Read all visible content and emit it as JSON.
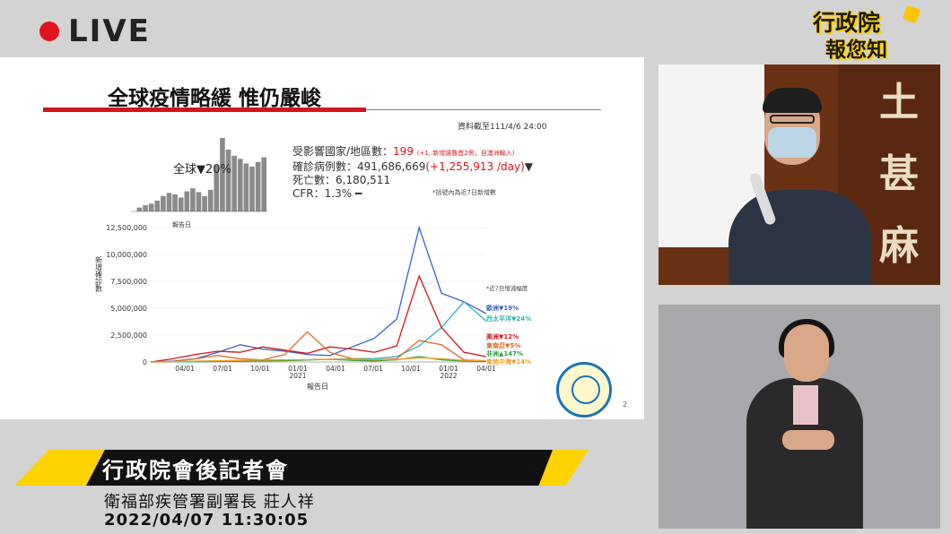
{
  "live": {
    "text": "LIVE"
  },
  "brand": {
    "line1": "行政院",
    "line2": "報您知"
  },
  "slide": {
    "title": "全球疫情略緩 惟仍嚴峻",
    "as_of": "資料截至111/4/6 24:00",
    "stats": {
      "countries_label": "受影響國家/地區數：",
      "countries_value": "199",
      "countries_note": "(+1, 新增諾魯首2例，自澳洲輸入)",
      "cases_label": "確診病例數：491,686,669",
      "cases_delta": "(+1,255,913 /day)",
      "cases_trend": "▼",
      "deaths": "死亡數：6,180,511",
      "cfr": "CFR：1.3%",
      "cfr_trend": "━"
    },
    "avg_note": "*括號內為近7日新增數",
    "mini_chart_label": "全球▼20%",
    "mini_x_label": "報告日",
    "page_number": "2"
  },
  "chart_data": {
    "type": "line",
    "ylabel": "新增確診數",
    "xlabel": "報告日",
    "y_ticks": [
      "12,500,000",
      "10,000,000",
      "7,500,000",
      "5,000,000",
      "2,500,000",
      "0"
    ],
    "ylim": [
      0,
      12500000
    ],
    "x_ticks": [
      "04/01",
      "07/01",
      "10/01",
      "01/01\n2021",
      "04/01",
      "07/01",
      "10/01",
      "01/01\n2022",
      "04/01"
    ],
    "legend_title": "近7日增減幅度",
    "series": [
      {
        "name": "歐洲▼19%",
        "color": "#3a63c8",
        "values": [
          0,
          80000,
          300000,
          900000,
          1600000,
          1200000,
          1000000,
          700000,
          600000,
          1400000,
          2200000,
          4000000,
          12500000,
          6400000,
          5600000,
          4500000
        ]
      },
      {
        "name": "西太平洋▼24%",
        "color": "#2ab5b5",
        "values": [
          0,
          10000,
          20000,
          40000,
          60000,
          80000,
          120000,
          180000,
          260000,
          300000,
          320000,
          500000,
          1500000,
          3200000,
          5600000,
          3800000
        ]
      },
      {
        "name": "美洲▼12%",
        "color": "#d2161e",
        "values": [
          0,
          300000,
          700000,
          1000000,
          900000,
          1400000,
          1100000,
          800000,
          1400000,
          1200000,
          900000,
          1500000,
          8000000,
          3200000,
          900000,
          500000
        ]
      },
      {
        "name": "東南亞▼5%",
        "color": "#e06a2a",
        "values": [
          0,
          50000,
          300000,
          600000,
          300000,
          200000,
          700000,
          2800000,
          900000,
          300000,
          200000,
          300000,
          2000000,
          1600000,
          200000,
          100000
        ]
      },
      {
        "name": "非洲▲147%",
        "color": "#2aa33a",
        "values": [
          0,
          20000,
          60000,
          80000,
          100000,
          120000,
          140000,
          200000,
          250000,
          150000,
          100000,
          200000,
          500000,
          200000,
          80000,
          60000
        ]
      },
      {
        "name": "東地中海▼14%",
        "color": "#f0a020",
        "values": [
          0,
          30000,
          80000,
          120000,
          150000,
          180000,
          200000,
          220000,
          260000,
          240000,
          200000,
          220000,
          400000,
          300000,
          150000,
          120000
        ]
      }
    ]
  },
  "mini_chart": {
    "values": [
      0,
      5,
      8,
      10,
      14,
      20,
      24,
      22,
      18,
      26,
      30,
      25,
      20,
      28,
      60,
      95,
      80,
      72,
      68,
      62,
      58,
      64,
      70
    ]
  },
  "lower_third": {
    "title": "行政院會後記者會",
    "subtitle": "衛福部疾管署副署長 莊人祥",
    "timestamp": "2022/04/07  11:30:05"
  },
  "camera_feed": {
    "wall_chars": [
      "土",
      "甚",
      "麻"
    ]
  }
}
